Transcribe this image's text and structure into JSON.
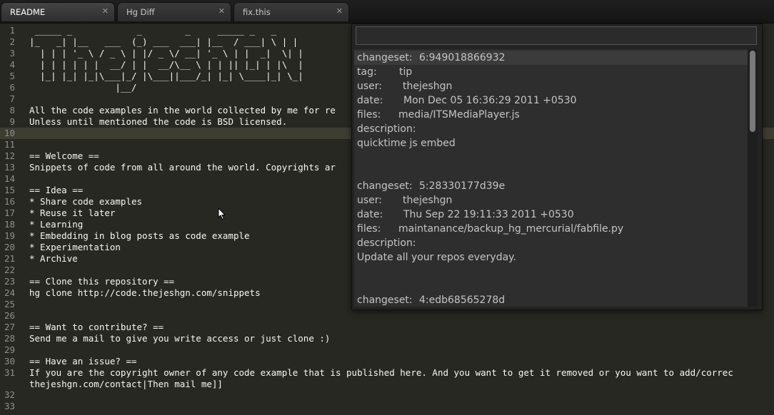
{
  "tabs": [
    {
      "label": "README",
      "close": "✕",
      "active": true
    },
    {
      "label": "Hg Diff",
      "close": "✕",
      "active": false
    },
    {
      "label": "fix.this",
      "close": "✕",
      "active": false
    }
  ],
  "editor": {
    "current_line": 10,
    "lines": [
      {
        "num": "1",
        "text": " _____ _            _        _     _____ _   _ "
      },
      {
        "num": "2",
        "text": "|_   _| |__   ___  (_) ___  ___| |__  / ___| \\ | |"
      },
      {
        "num": "3",
        "text": "  | | | '_ \\ / _ \\ | |/ _ \\/ __| '_ \\ | |  _|  \\| |"
      },
      {
        "num": "4",
        "text": "  | | | | | |  __/ | |  __/\\__ \\ | | || |_| | |\\  |"
      },
      {
        "num": "5",
        "text": "  |_| |_| |_|\\___|_/ |\\___||___/_| |_| \\____|_| \\_|"
      },
      {
        "num": "6",
        "text": "                |__/"
      },
      {
        "num": "7",
        "text": ""
      },
      {
        "num": "8",
        "text": "All the code examples in the world collected by me for re"
      },
      {
        "num": "9",
        "text": "Unless until mentioned the code is BSD licensed."
      },
      {
        "num": "10",
        "text": ""
      },
      {
        "num": "11",
        "text": ""
      },
      {
        "num": "12",
        "text": "== Welcome =="
      },
      {
        "num": "13",
        "text": "Snippets of code from all around the world. Copyrights ar"
      },
      {
        "num": "14",
        "text": ""
      },
      {
        "num": "15",
        "text": "== Idea =="
      },
      {
        "num": "16",
        "text": "* Share code examples"
      },
      {
        "num": "17",
        "text": "* Reuse it later"
      },
      {
        "num": "18",
        "text": "* Learning"
      },
      {
        "num": "19",
        "text": "* Embedding in blog posts as code example"
      },
      {
        "num": "20",
        "text": "* Experimentation"
      },
      {
        "num": "21",
        "text": "* Archive"
      },
      {
        "num": "22",
        "text": ""
      },
      {
        "num": "23",
        "text": "== Clone this repository =="
      },
      {
        "num": "24",
        "text": "hg clone http://code.thejeshgn.com/snippets"
      },
      {
        "num": "25",
        "text": ""
      },
      {
        "num": "26",
        "text": ""
      },
      {
        "num": "27",
        "text": "== Want to contribute? =="
      },
      {
        "num": "28",
        "text": "Send me a mail to give you write access or just clone :)"
      },
      {
        "num": "29",
        "text": ""
      },
      {
        "num": "30",
        "text": "== Have an issue? =="
      },
      {
        "num": "31",
        "text": "If you are the copyright owner of any code example that is published here. And you want to get it removed or you want to add/correc"
      },
      {
        "num": "",
        "text": "thejeshgn.com/contact|Then mail me]]"
      },
      {
        "num": "32",
        "text": ""
      },
      {
        "num": "33",
        "text": ""
      }
    ]
  },
  "quick_panel": {
    "input_value": "",
    "entries": [
      {
        "key": "changeset:",
        "value": "6:949018866932",
        "selected": true
      },
      {
        "key": "tag:",
        "value": "tip"
      },
      {
        "key": "user:",
        "value": "thejeshgn"
      },
      {
        "key": "date:",
        "value": "Mon Dec 05 16:36:29 2011 +0530"
      },
      {
        "key": "files:",
        "value": "media/ITSMediaPlayer.js"
      },
      {
        "key": "description:",
        "value": ""
      },
      {
        "key": "quicktime js embed",
        "value": ""
      },
      {
        "key": "",
        "value": ""
      },
      {
        "key": "",
        "value": ""
      },
      {
        "key": "changeset:",
        "value": "5:28330177d39e"
      },
      {
        "key": "user:",
        "value": "thejeshgn"
      },
      {
        "key": "date:",
        "value": "Thu Sep 22 19:11:33 2011 +0530"
      },
      {
        "key": "files:",
        "value": "maintanance/backup_hg_mercurial/fabfile.py"
      },
      {
        "key": "description:",
        "value": ""
      },
      {
        "key": "Update all your repos everyday.",
        "value": ""
      },
      {
        "key": "",
        "value": ""
      },
      {
        "key": "",
        "value": ""
      },
      {
        "key": "changeset:",
        "value": "4:edb68565278d"
      }
    ]
  },
  "colors": {
    "background": "#272822",
    "foreground": "#f8f8f2",
    "gutter": "#8f908a",
    "current_line": "#3e3d32",
    "panel_background": "#2e2e2e",
    "panel_text": "#c5c5c5"
  }
}
